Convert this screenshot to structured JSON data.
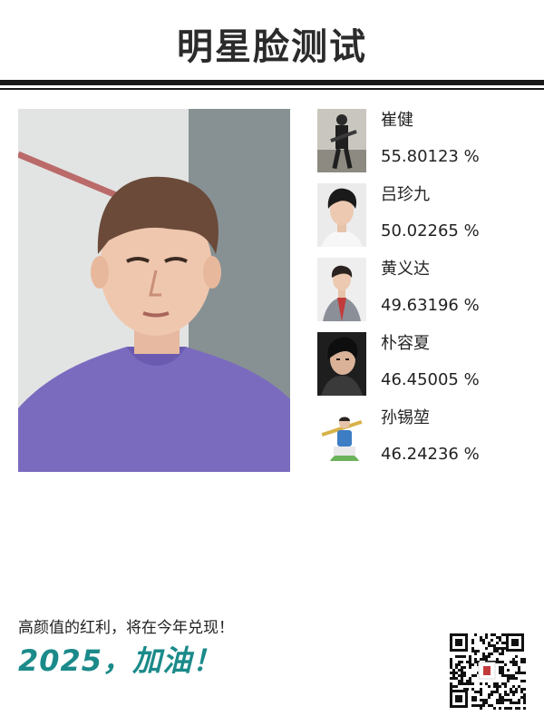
{
  "header": {
    "title": "明星脸测试"
  },
  "photo": {
    "icon": "user-photo"
  },
  "results": [
    {
      "name": "崔健",
      "score": "55.80123 %",
      "icon": "celebrity-thumbnail"
    },
    {
      "name": "吕珍九",
      "score": "50.02265 %",
      "icon": "celebrity-thumbnail"
    },
    {
      "name": "黄义达",
      "score": "49.63196 %",
      "icon": "celebrity-thumbnail"
    },
    {
      "name": "朴容夏",
      "score": "46.45005 %",
      "icon": "celebrity-thumbnail"
    },
    {
      "name": "孙锡堃",
      "score": "46.24236 %",
      "icon": "celebrity-thumbnail"
    }
  ],
  "footer": {
    "slogan": "高颜值的红利，将在今年兑现！",
    "year_line": "2025，加油！",
    "qr_icon": "qr-code-icon"
  },
  "colors": {
    "title": "#2b2b2b",
    "rule": "#1a1a1a",
    "accent": "#1b8a8a",
    "shirt": "#7b6bbf"
  }
}
